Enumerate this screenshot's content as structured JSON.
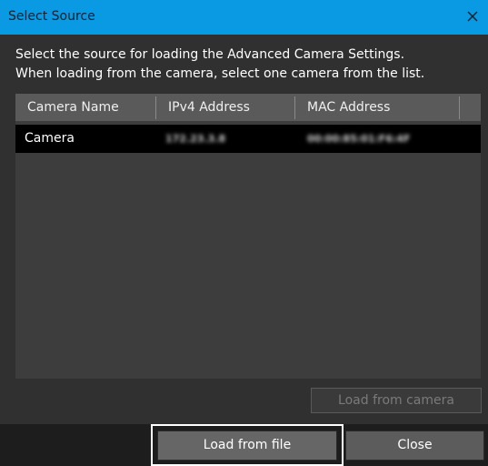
{
  "window": {
    "title": "Select Source",
    "close_icon": "close-icon"
  },
  "instructions": {
    "line1": "Select the source for loading the Advanced Camera Settings.",
    "line2": "When loading from the camera, select one camera from the list."
  },
  "camera_list": {
    "columns": [
      "Camera Name",
      "IPv4 Address",
      "MAC Address"
    ],
    "rows": [
      {
        "name": "Camera",
        "ipv4": "172.23.3.8",
        "mac": "00:00:85:01:F6:4F"
      }
    ]
  },
  "buttons": {
    "load_from_camera": "Load from camera",
    "load_from_file": "Load from file",
    "close": "Close"
  },
  "colors": {
    "titlebar": "#0a9ae4",
    "selected_row": "#000000",
    "panel": "#303030"
  }
}
